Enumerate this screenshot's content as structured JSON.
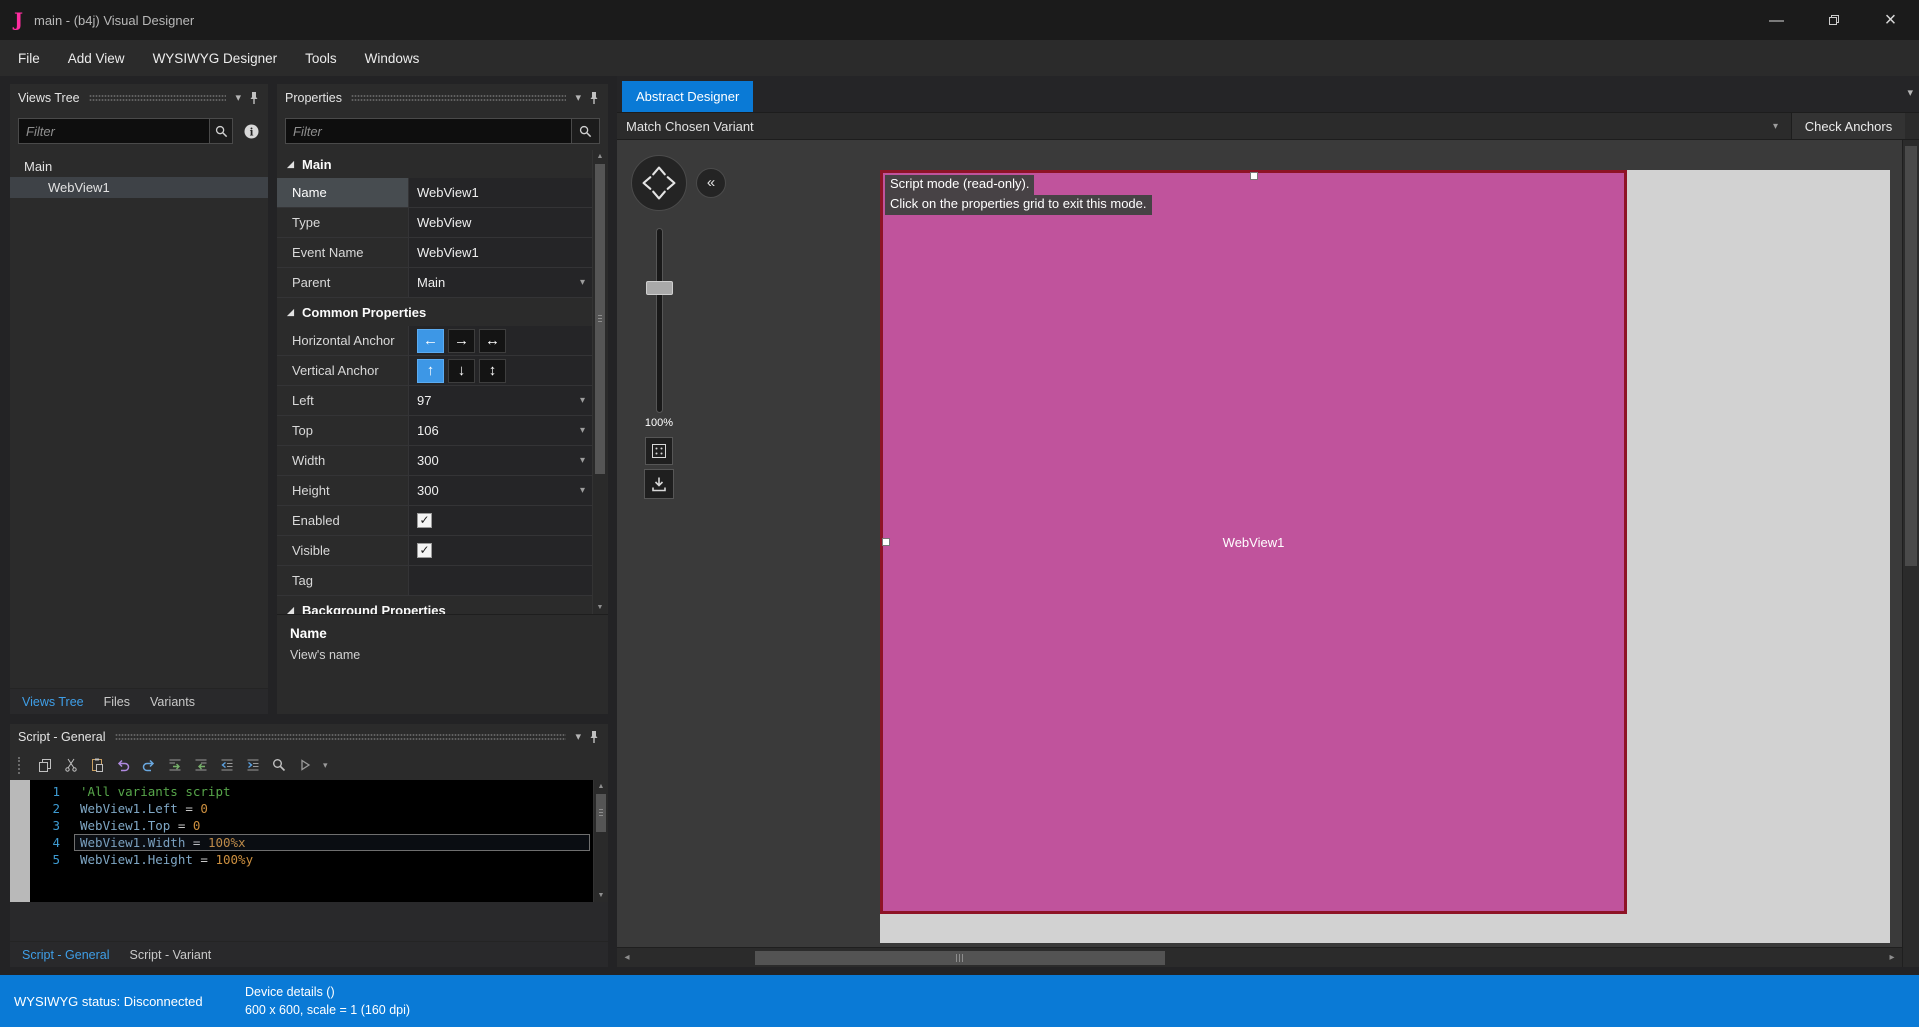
{
  "window": {
    "logo_letter": "J",
    "title": "main - (b4j) Visual Designer"
  },
  "menubar": {
    "items": [
      "File",
      "Add View",
      "WYSIWYG Designer",
      "Tools",
      "Windows"
    ]
  },
  "glyphs": {
    "caret_down": "▾",
    "collapse": "«",
    "up": "▲",
    "down": "▼",
    "left": "◂",
    "right": "▸",
    "minimize": "—",
    "close": "×",
    "check": "✓"
  },
  "views_tree_panel": {
    "title": "Views Tree",
    "filter_placeholder": "Filter",
    "tree": [
      {
        "label": "Main",
        "indent": 0,
        "selected": false
      },
      {
        "label": "WebView1",
        "indent": 1,
        "selected": true
      }
    ],
    "tabs": [
      {
        "label": "Views Tree",
        "active": true
      },
      {
        "label": "Files",
        "active": false
      },
      {
        "label": "Variants",
        "active": false
      }
    ]
  },
  "properties_panel": {
    "title": "Properties",
    "filter_placeholder": "Filter",
    "sections": [
      {
        "title": "Main",
        "rows": [
          {
            "label": "Name",
            "value": "WebView1",
            "selected": true
          },
          {
            "label": "Type",
            "value": "WebView"
          },
          {
            "label": "Event Name",
            "value": "WebView1"
          },
          {
            "label": "Parent",
            "value": "Main",
            "dropdown": true
          }
        ]
      },
      {
        "title": "Common Properties",
        "rows": [
          {
            "label": "Horizontal Anchor",
            "anchors": [
              "←",
              "→",
              "↔"
            ],
            "anchor_selected": 0
          },
          {
            "label": "Vertical Anchor",
            "anchors": [
              "↑",
              "↓",
              "↕"
            ],
            "anchor_selected": 0
          },
          {
            "label": "Left",
            "value": "97",
            "dropdown": true
          },
          {
            "label": "Top",
            "value": "106",
            "dropdown": true
          },
          {
            "label": "Width",
            "value": "300",
            "dropdown": true
          },
          {
            "label": "Height",
            "value": "300",
            "dropdown": true
          },
          {
            "label": "Enabled",
            "checkbox": true
          },
          {
            "label": "Visible",
            "checkbox": true
          },
          {
            "label": "Tag",
            "value": ""
          }
        ]
      }
    ],
    "clipped_section": "Background Properties",
    "description_title": "Name",
    "description_text": "View's name"
  },
  "script_panel": {
    "title": "Script - General",
    "toolbar_icons": [
      "copy",
      "cut",
      "paste",
      "undo",
      "redo",
      "comment",
      "uncomment",
      "indent-decrease",
      "indent-increase",
      "find",
      "run"
    ],
    "code": [
      {
        "n": 1,
        "segs": [
          [
            "comment",
            "'All variants script"
          ]
        ]
      },
      {
        "n": 2,
        "segs": [
          [
            "ident",
            "WebView1.Left"
          ],
          [
            "op",
            " = "
          ],
          [
            "num",
            "0"
          ]
        ]
      },
      {
        "n": 3,
        "segs": [
          [
            "ident",
            "WebView1.Top"
          ],
          [
            "op",
            " = "
          ],
          [
            "num",
            "0"
          ]
        ]
      },
      {
        "n": 4,
        "current": true,
        "segs": [
          [
            "ident",
            "WebView1.Width"
          ],
          [
            "op",
            " = "
          ],
          [
            "num",
            "100%x"
          ]
        ]
      },
      {
        "n": 5,
        "segs": [
          [
            "ident",
            "WebView1.Height"
          ],
          [
            "op",
            " = "
          ],
          [
            "num",
            "100%y"
          ]
        ]
      }
    ],
    "tabs": [
      {
        "label": "Script - General",
        "active": true
      },
      {
        "label": "Script - Variant",
        "active": false
      }
    ]
  },
  "designer": {
    "tab_label": "Abstract Designer",
    "variant_selector": "Match Chosen Variant",
    "check_anchors_label": "Check Anchors",
    "zoom_label": "100%",
    "overlay_line1": "Script mode (read-only).",
    "overlay_line2": "Click on the properties grid to exit this mode.",
    "widget_label": "WebView1",
    "colors": {
      "widget_fill": "#c0539c",
      "widget_border": "#8e1326",
      "form_bg": "#d2d2d2",
      "canvas_bg": "#3a3a3a",
      "accent": "#0a7ad6"
    }
  },
  "statusbar": {
    "left": "WYSIWYG status: Disconnected",
    "device_line1": "Device details ()",
    "device_line2": "600 x 600, scale = 1 (160 dpi)",
    "bg": "#0a7ad6"
  }
}
